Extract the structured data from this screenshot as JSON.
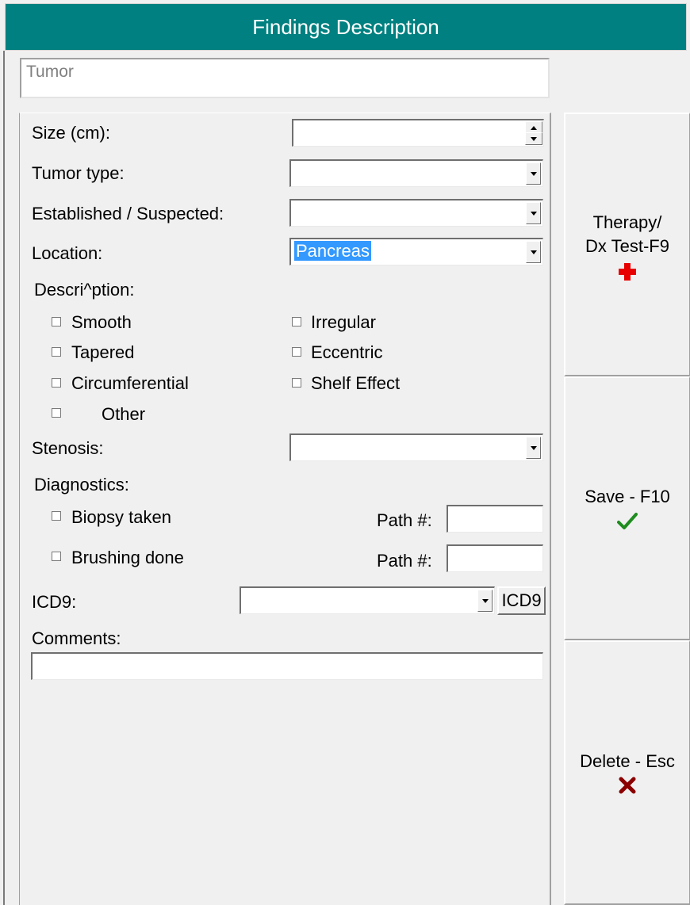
{
  "title": "Findings Description",
  "finding_name": "Tumor",
  "form": {
    "size_label": "Size (cm):",
    "size_value": "",
    "tumor_type_label": "Tumor type:",
    "tumor_type_value": "",
    "established_label": "Established / Suspected:",
    "established_value": "",
    "location_label": "Location:",
    "location_value": "Pancreas",
    "description_label": "Descri^ption:",
    "description_options": [
      {
        "label": "Smooth",
        "checked": false
      },
      {
        "label": "Irregular",
        "checked": false
      },
      {
        "label": "Tapered",
        "checked": false
      },
      {
        "label": "Eccentric",
        "checked": false
      },
      {
        "label": "Circumferential",
        "checked": false
      },
      {
        "label": "Shelf Effect",
        "checked": false
      },
      {
        "label": "Other",
        "checked": false
      }
    ],
    "stenosis_label": "Stenosis:",
    "stenosis_value": "",
    "diagnostics_label": "Diagnostics:",
    "biopsy_label": "Biopsy taken",
    "brushing_label": "Brushing done",
    "path_label": "Path #:",
    "biopsy_path_value": "",
    "brushing_path_value": "",
    "icd9_label": "ICD9:",
    "icd9_value": "",
    "icd9_button": "ICD9",
    "comments_label": "Comments:",
    "comments_value": ""
  },
  "actions": {
    "therapy_line1": "Therapy/",
    "therapy_line2": "Dx Test-F9",
    "save": "Save - F10",
    "delete": "Delete - Esc"
  },
  "colors": {
    "title_bar": "#008080",
    "selection": "#3399ff",
    "therapy_icon": "#e80000",
    "save_icon": "#1e8c1e",
    "delete_icon": "#8b0000"
  },
  "icons": {
    "therapy": "red-cross-icon",
    "save": "checkmark-icon",
    "delete": "x-mark-icon"
  }
}
